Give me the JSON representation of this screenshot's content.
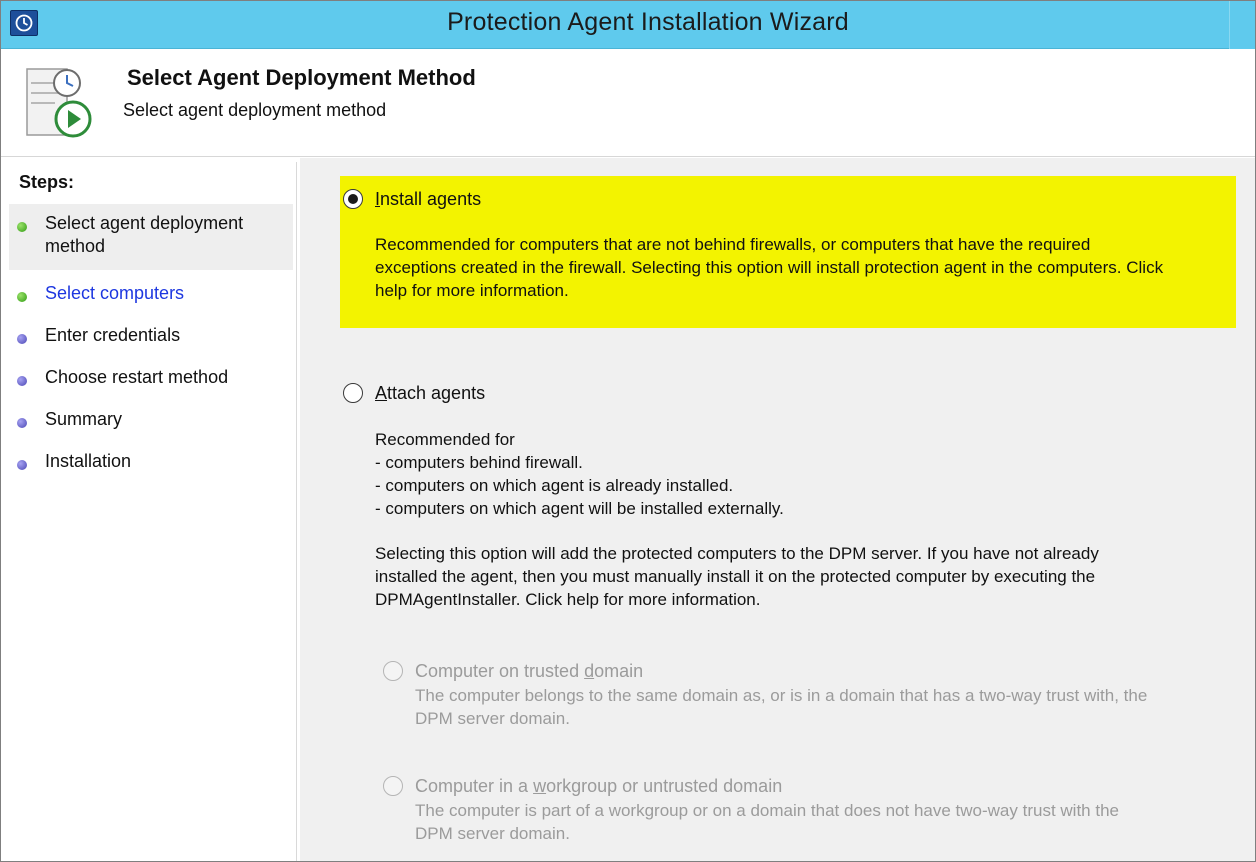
{
  "window": {
    "title": "Protection Agent Installation Wizard"
  },
  "header": {
    "title": "Select Agent Deployment Method",
    "subtitle": "Select agent deployment method"
  },
  "sidebar": {
    "steps_label": "Steps:",
    "steps": [
      {
        "label_line1": "Select agent deployment",
        "label_line2": "method",
        "state": "current",
        "dot_color": "#2f9b12"
      },
      {
        "label": "Select computers",
        "state": "link",
        "dot_color": "#2f9b12"
      },
      {
        "label": "Enter credentials",
        "state": "pending",
        "dot_color": "#4a47b4"
      },
      {
        "label": "Choose restart method",
        "state": "pending",
        "dot_color": "#4a47b4"
      },
      {
        "label": "Summary",
        "state": "pending",
        "dot_color": "#4a47b4"
      },
      {
        "label": "Installation",
        "state": "pending",
        "dot_color": "#4a47b4"
      }
    ]
  },
  "main": {
    "install": {
      "selected": true,
      "label_first": "I",
      "label_rest": "nstall agents",
      "desc": [
        "Recommended for computers that are not behind firewalls, or computers that have the required",
        "exceptions created in the firewall. Selecting this option will install protection agent in the computers. Click",
        "help for more information."
      ]
    },
    "attach": {
      "selected": false,
      "label_first": "A",
      "label_rest": "ttach agents",
      "desc1": [
        "Recommended for",
        "- computers behind firewall.",
        "- computers on which agent is already installed.",
        "- computers on which agent will be installed externally."
      ],
      "desc2": [
        "Selecting this option will add the protected computers to the DPM server. If you have not already",
        "installed the agent, then you must manually install it on the protected computer by executing the",
        "DPMAgentInstaller. Click help for more information."
      ]
    },
    "trusted": {
      "selected": false,
      "enabled": false,
      "label_before": "Computer on trusted ",
      "label_accel": "d",
      "label_after": "omain",
      "desc": [
        "The computer belongs to the same domain as, or is in a domain that has a two-way trust with, the",
        "DPM server domain."
      ]
    },
    "workgroup": {
      "selected": false,
      "enabled": false,
      "label_before": "Computer in a ",
      "label_accel": "w",
      "label_after": "orkgroup or untrusted domain",
      "desc": [
        "The computer is part of a workgroup or on a domain that does not have two-way trust with the",
        "DPM server domain."
      ]
    },
    "highlight_color": "#f3f300"
  },
  "icons": {
    "app": "wizard-clock-icon",
    "header": "agent-deploy-icon"
  }
}
